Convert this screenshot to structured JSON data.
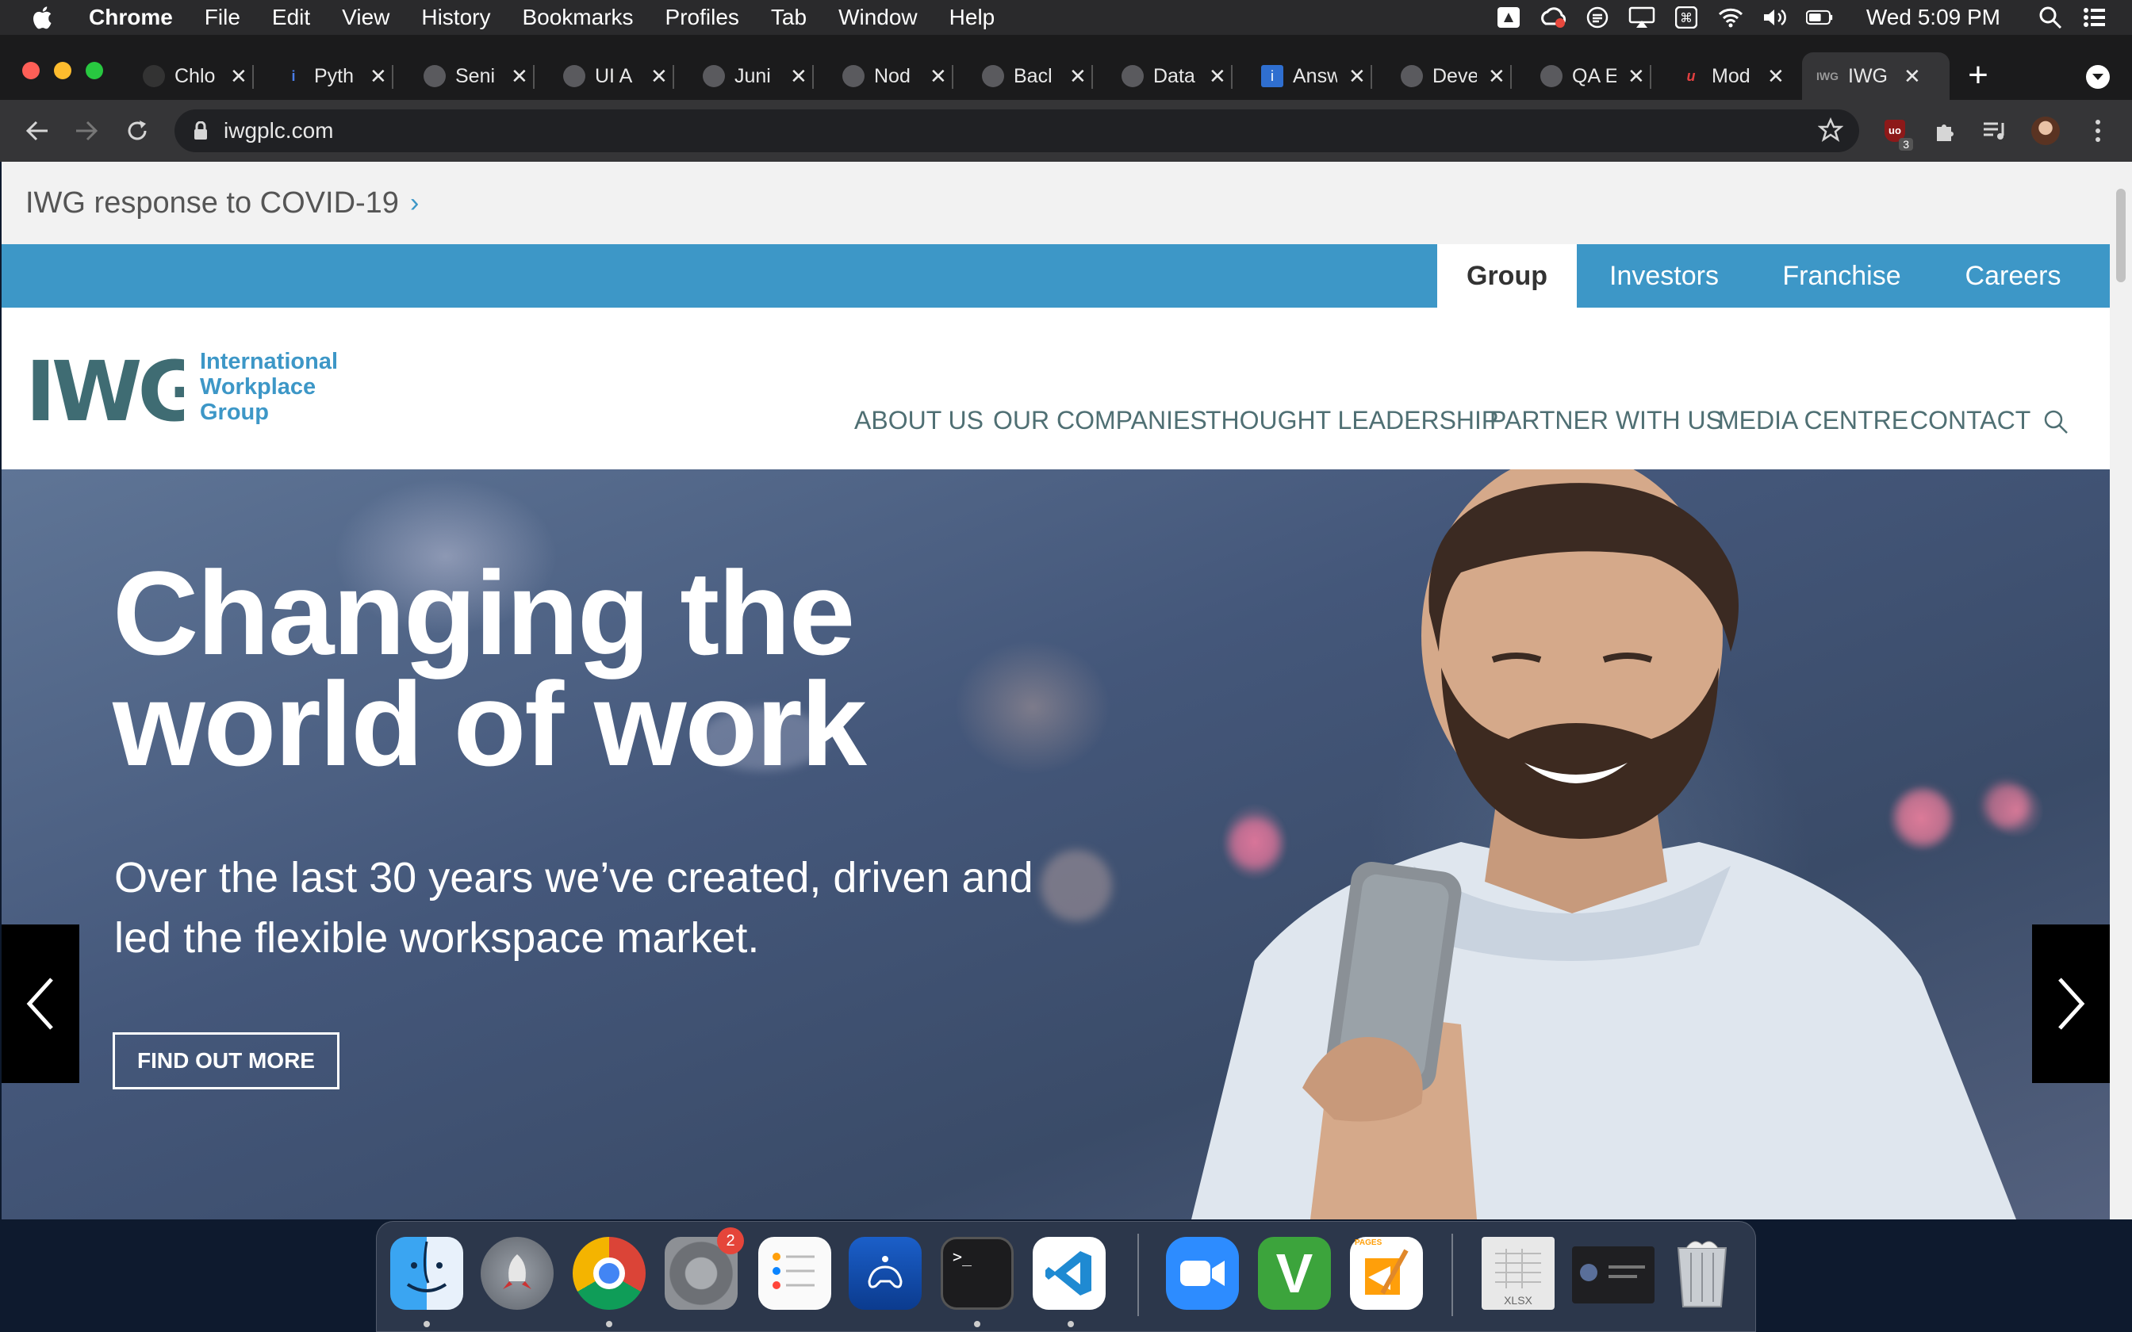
{
  "menubar": {
    "app": "Chrome",
    "items": [
      "File",
      "Edit",
      "View",
      "History",
      "Bookmarks",
      "Profiles",
      "Tab",
      "Window",
      "Help"
    ],
    "clock": "Wed 5:09 PM"
  },
  "tabs": [
    {
      "title": "Chlo"
    },
    {
      "title": "Pyth"
    },
    {
      "title": "Seni"
    },
    {
      "title": "UI A"
    },
    {
      "title": "Juni"
    },
    {
      "title": "Nod"
    },
    {
      "title": "Bacl"
    },
    {
      "title": "Data"
    },
    {
      "title": "Answ"
    },
    {
      "title": "Deve"
    },
    {
      "title": "QA E"
    },
    {
      "title": "Mod"
    },
    {
      "title": "IWG"
    }
  ],
  "toolbar": {
    "url": "iwgplc.com",
    "ext_badge": "3"
  },
  "site": {
    "covid_link": "IWG response to COVID-19",
    "covid_chevron": "›",
    "group_tabs": [
      "Group",
      "Investors",
      "Franchise",
      "Careers"
    ],
    "logo": {
      "mark": "IWG",
      "line1": "International",
      "line2": "Workplace",
      "line3": "Group"
    },
    "nav": [
      "ABOUT US",
      "OUR COMPANIES",
      "THOUGHT LEADERSHIP",
      "PARTNER WITH US",
      "MEDIA CENTRE",
      "CONTACT"
    ],
    "hero": {
      "title_line1": "Changing the",
      "title_line2": "world of work",
      "text_line1": "Over the last 30 years we’ve created, driven and",
      "text_line2": "led the flexible workspace market.",
      "cta": "FIND OUT MORE"
    }
  },
  "dock": {
    "badge": "2",
    "xlsx_label": "XLSX",
    "pages_label": "PAGES"
  },
  "colors": {
    "brand_blue": "#3d97c7",
    "brand_teal": "#3f6c73",
    "nav_text": "#4f6f73"
  }
}
